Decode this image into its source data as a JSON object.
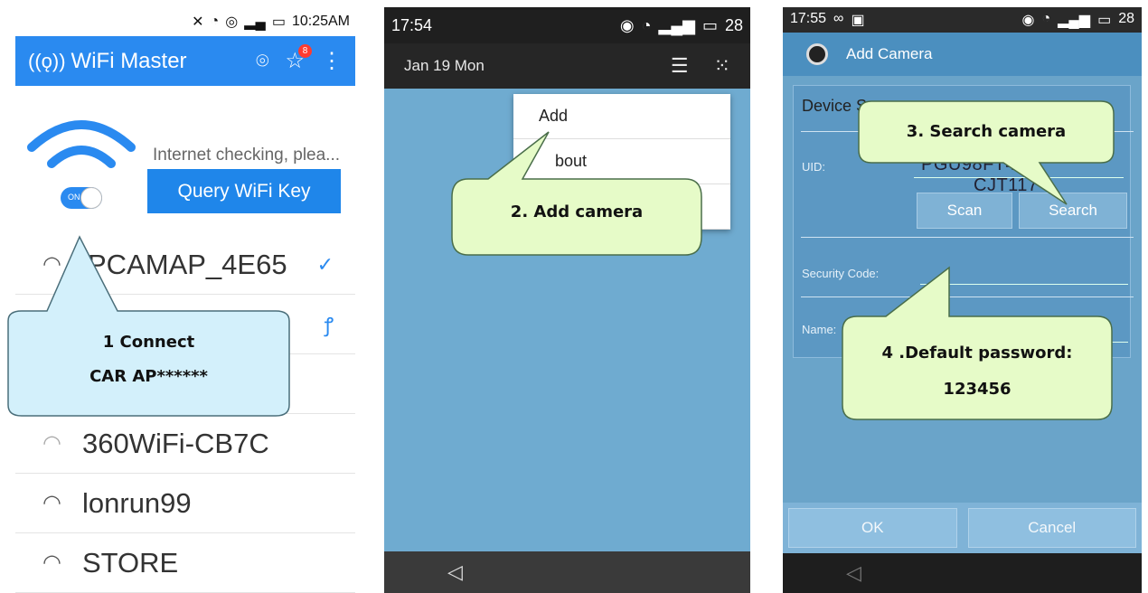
{
  "panel1": {
    "status": {
      "time": "10:25AM"
    },
    "app_title": "WiFi Master",
    "badge_count": "8",
    "internet_status": "Internet checking, plea...",
    "toggle_label": "ON",
    "query_button": "Query WiFi Key",
    "networks": [
      {
        "ssid": "PCAMAP_4E65",
        "state": "connected"
      },
      {
        "ssid": "",
        "state": "key"
      },
      {
        "ssid": "",
        "state": ""
      },
      {
        "ssid": "360WiFi-CB7C",
        "state": "open"
      },
      {
        "ssid": "lonrun99",
        "state": "locked"
      },
      {
        "ssid": "STORE",
        "state": "locked"
      }
    ],
    "callout": {
      "line1": "1 Connect",
      "line2": "CAR AP******"
    }
  },
  "panel2": {
    "status": {
      "time": "17:54",
      "battery": "28"
    },
    "date": "Jan 19  Mon",
    "menu": [
      "Add",
      "bout",
      ""
    ],
    "callout": "2. Add camera"
  },
  "panel3": {
    "status": {
      "time": "17:55",
      "battery": "28"
    },
    "title": "Add Camera",
    "section": "Device S",
    "uid_label": "UID:",
    "uid_value": "PGU98FT4A",
    "uid_value_tail": "CJT117",
    "scan": "Scan",
    "search": "Search",
    "security_label": "Security Code:",
    "name_label": "Name:",
    "ok": "OK",
    "cancel": "Cancel",
    "callout_search": "3. Search camera",
    "callout_password": {
      "line1": "4 .Default password:",
      "line2": "123456"
    }
  },
  "colors": {
    "callout_green": "#e6fbc8",
    "callout_blue": "#d3f0fb",
    "accent_blue": "#2a8af0"
  }
}
